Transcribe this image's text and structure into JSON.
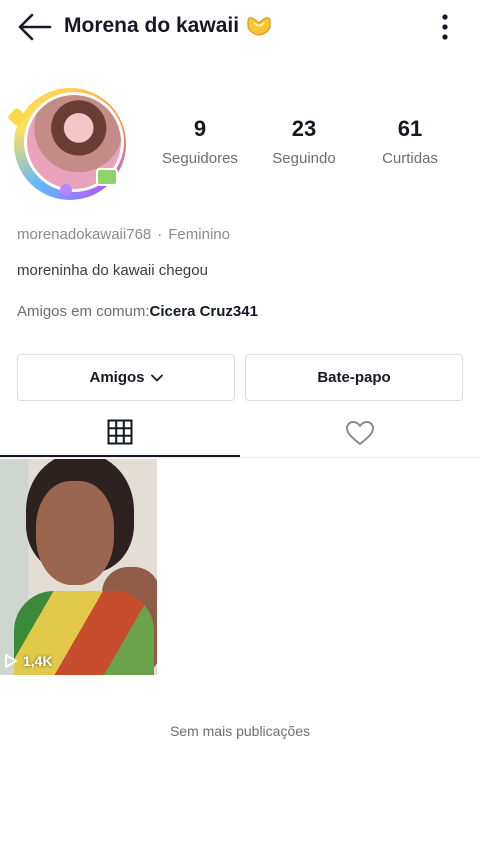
{
  "header": {
    "title": "Morena do kawaii",
    "title_emoji": "heart-hands-emoji"
  },
  "profile": {
    "stats": [
      {
        "value": "9",
        "label": "Seguidores"
      },
      {
        "value": "23",
        "label": "Seguindo"
      },
      {
        "value": "61",
        "label": "Curtidas"
      }
    ],
    "username": "morenadokawaii768",
    "separator": "·",
    "gender": "Feminino",
    "bio": "moreninha do kawaii chegou",
    "mutual_label": "Amigos em comum:",
    "mutual_name": "Cicera Cruz341"
  },
  "actions": {
    "friends_label": "Amigos",
    "chat_label": "Bate-papo"
  },
  "tabs": [
    {
      "icon": "grid-icon",
      "selected": true
    },
    {
      "icon": "heart-icon",
      "selected": false
    }
  ],
  "videos": [
    {
      "views": "1,4K"
    }
  ],
  "footer": {
    "no_more": "Sem mais publicações"
  },
  "colors": {
    "text_primary": "#161823",
    "text_secondary": "#6b6d75",
    "border": "#dcdde0"
  }
}
